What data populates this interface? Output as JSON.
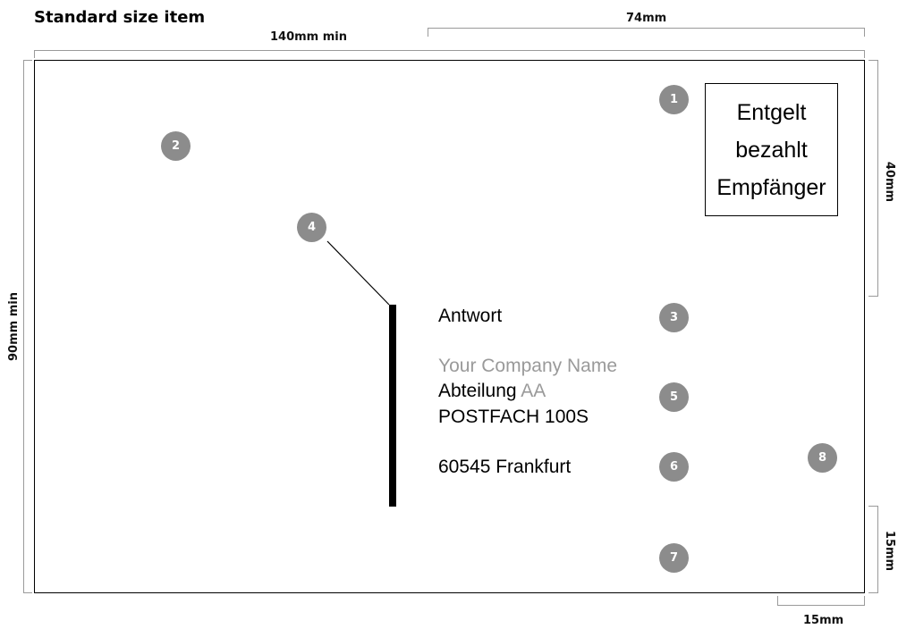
{
  "title": "Standard size item",
  "dimensions": {
    "width_min": "140mm min",
    "height_min": "90mm min",
    "stamp_zone_width": "74mm",
    "stamp_zone_height": "40mm",
    "bottom_clear_height": "15mm",
    "right_clear_width": "15mm"
  },
  "stamp": {
    "line1": "Entgelt",
    "line2": "bezahlt",
    "line3": "Empfänger"
  },
  "address": {
    "reply_label": "Antwort",
    "company": "Your Company Name",
    "department_prefix": "Abteilung",
    "department_code": "AA",
    "postbox": "POSTFACH 100S",
    "city": "60545 Frankfurt"
  },
  "markers": [
    "1",
    "2",
    "3",
    "4",
    "5",
    "6",
    "7",
    "8"
  ],
  "colors": {
    "marker": "#8c8c8c",
    "dimension_line": "#9a9a9a",
    "placeholder_text": "#9a9a9a"
  }
}
